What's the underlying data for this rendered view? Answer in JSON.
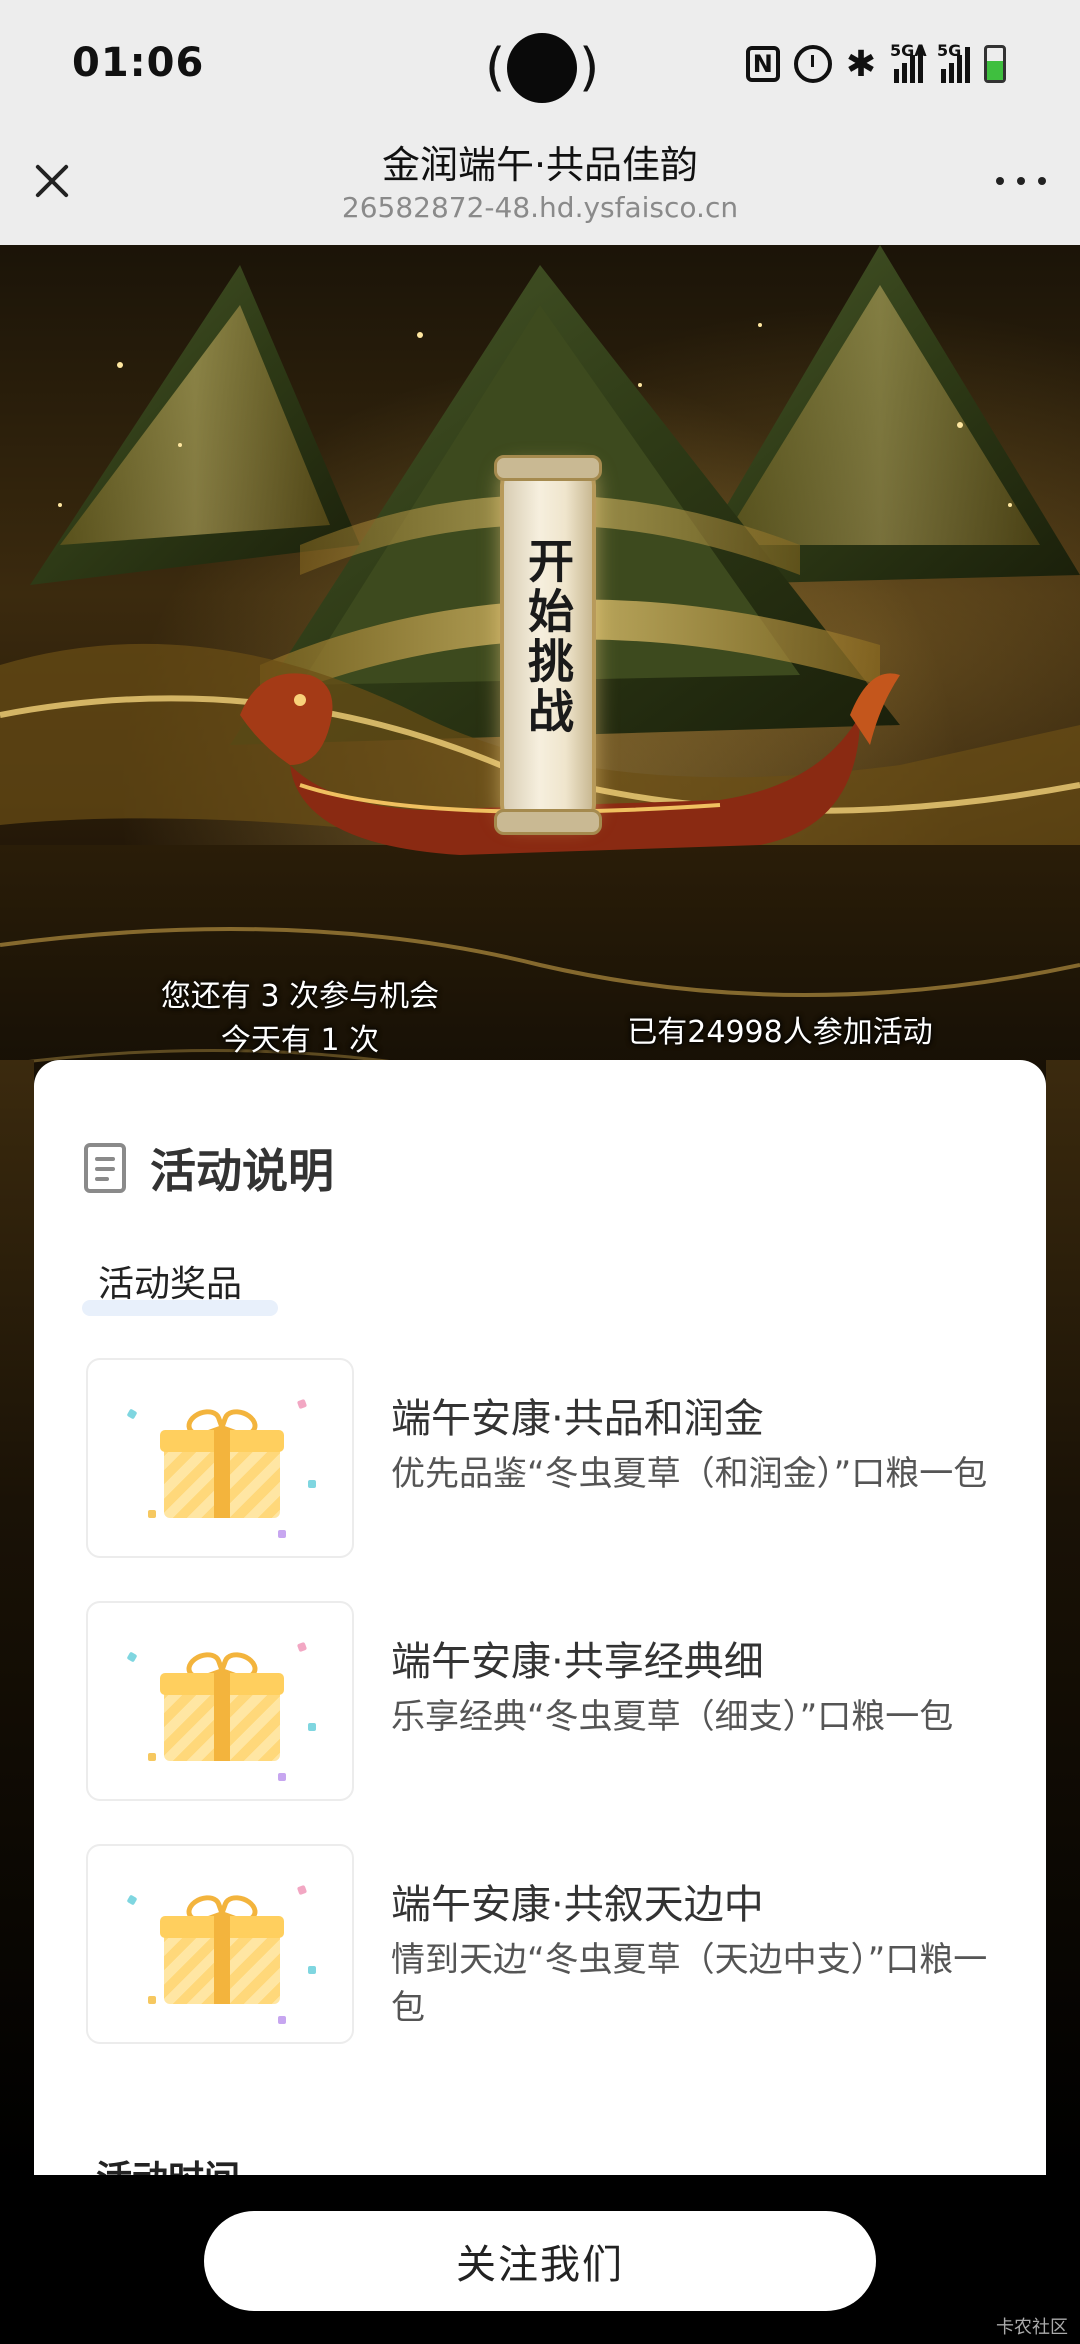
{
  "status_bar": {
    "time": "01:06",
    "nfc": "N",
    "signal1_label": "5GA",
    "signal2_label": "5G",
    "battery_level": 0.6,
    "icons": [
      "nfc-icon",
      "alarm-icon",
      "bluetooth-icon",
      "signal-5ga-icon",
      "signal-5g-icon",
      "battery-icon"
    ]
  },
  "title_bar": {
    "title": "金润端午·共品佳韵",
    "url": "26582872-48.hd.ysfaisco.cn"
  },
  "hero": {
    "start_button": "开始挑战",
    "chances_line1": "您还有 3 次参与机会",
    "chances_line2": "今天有 1 次",
    "participants": "已有24998人参加活动"
  },
  "card": {
    "section_title": "活动说明",
    "prizes_heading": "活动奖品",
    "prizes": [
      {
        "name": "端午安康·共品和润金",
        "desc": "优先品鉴“冬虫夏草（和润金）”口粮一包"
      },
      {
        "name": "端午安康·共享经典细",
        "desc": "乐享经典“冬虫夏草（细支）”口粮一包"
      },
      {
        "name": "端午安康·共叙天边中",
        "desc": "情到天边“冬虫夏草（天边中支）”口粮一包"
      }
    ],
    "next_heading": "活动时间"
  },
  "bottom": {
    "follow_label": "关注我们",
    "watermark": "卡农社区"
  },
  "colors": {
    "status_bg": "#ededed",
    "card_bg": "#ffffff",
    "gift_yellow": "#ffd87a",
    "button_bg": "#ffffff"
  }
}
